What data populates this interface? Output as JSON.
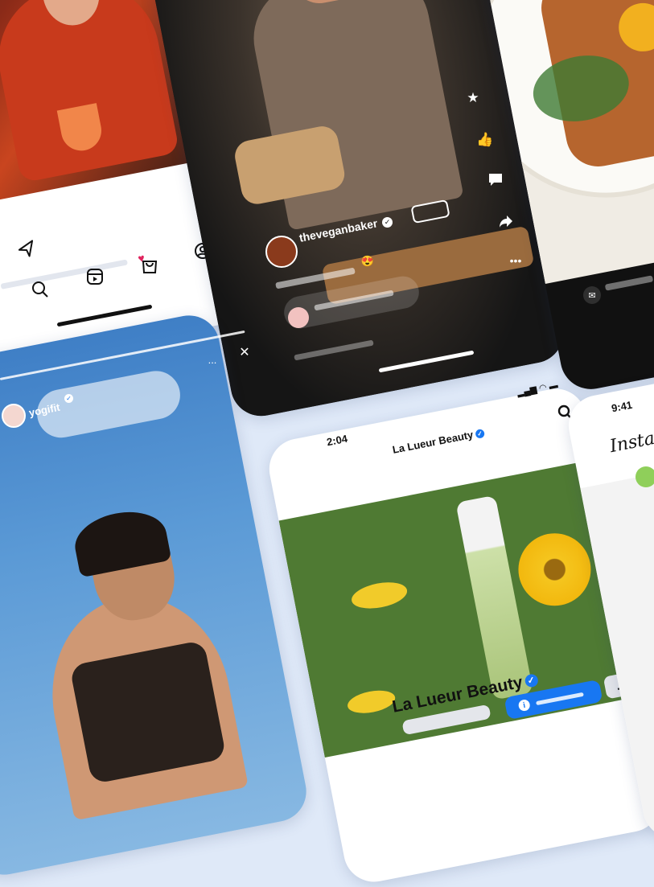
{
  "cocktail_post": {
    "heart_icon": "heart-icon",
    "bookmark_icon": "bookmark-icon",
    "send_icon": "send-icon"
  },
  "nav": {
    "icons": [
      "search-icon",
      "reels-icon",
      "shop-icon",
      "profile-icon"
    ]
  },
  "reel": {
    "username": "theveganbaker",
    "reaction_emoji": "😍"
  },
  "story": {
    "username": "yogifit",
    "more_label": "...",
    "close_label": "✕"
  },
  "brand_profile": {
    "time": "2:04",
    "title": "La Lueur Beauty",
    "name": "La Lueur Beauty",
    "more_label": "...",
    "info_label": "i"
  },
  "insta_profile": {
    "time": "9:41",
    "title": "Insta"
  },
  "colors": {
    "accent": "#1877f2",
    "background": "#dfe9f8",
    "reel_bg": "#111111"
  }
}
